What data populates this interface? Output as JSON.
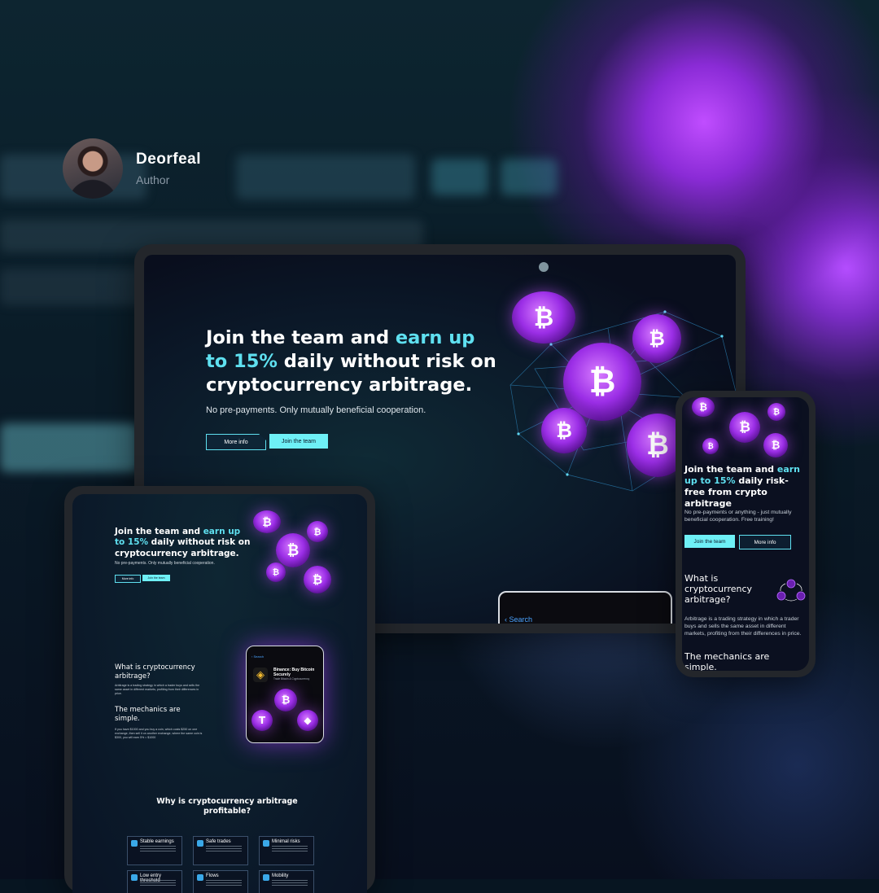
{
  "author": {
    "name": "Deorfeal",
    "role": "Author"
  },
  "laptop": {
    "headline_a": "Join the team and ",
    "headline_accent": "earn up to 15%",
    "headline_b": " daily without risk on cryptocurrency arbitrage.",
    "subtitle": "No pre-payments. Only mutually beneficial cooperation.",
    "btn_more": "More info",
    "btn_join": "Join the team",
    "search_label": "Search",
    "coin_symbol": "₿"
  },
  "tablet": {
    "headline_a": "Join the team and ",
    "headline_accent": "earn up to 15%",
    "headline_b": " daily without risk on cryptocurrency arbitrage.",
    "subtitle": "No pre-payments. Only mutually beneficial cooperation.",
    "btn_more": "More info",
    "btn_join": "Join the team",
    "what_title": "What is cryptocurrency arbitrage?",
    "what_text": "Arbitrage is a trading strategy in which a trader buys and sells the same asset in different markets, profiting from their differences in price.",
    "mech_title": "The mechanics are simple.",
    "mech_text": "If you have $1000 and you buy a coin, which costs $250 on one exchange, then sell it on another exchange, where the same coin is $300, you will earn 5% = $1000",
    "phone_back": "Search",
    "phone_card_title": "Binance: Buy Bitcoin Securely",
    "phone_card_sub": "Trade Bitcoin & Cryptocurrency",
    "why_title": "Why is cryptocurrency arbitrage profitable?",
    "features": [
      {
        "title": "Stable earnings"
      },
      {
        "title": "Safe trades"
      },
      {
        "title": "Minimal risks"
      },
      {
        "title": "Low entry threshold"
      },
      {
        "title": "Flows"
      },
      {
        "title": "Mobility"
      }
    ]
  },
  "phone": {
    "headline_a": "Join the team and ",
    "headline_accent": "earn up to 15%",
    "headline_b": " daily risk-free from crypto arbitrage",
    "subtitle": "No pre-payments or anything - just mutually beneficial cooperation. Free training!",
    "btn_join": "Join the team",
    "btn_more": "More info",
    "what_title": "What is cryptocurrency arbitrage?",
    "what_text": "Arbitrage is a trading strategy in which a trader buys and sells the same asset in different markets, profiting from their differences in price.",
    "mech_title": "The mechanics are simple."
  },
  "colors": {
    "accent": "#5fe0f0",
    "coin": "#9b2ee6",
    "background": "#071521"
  }
}
